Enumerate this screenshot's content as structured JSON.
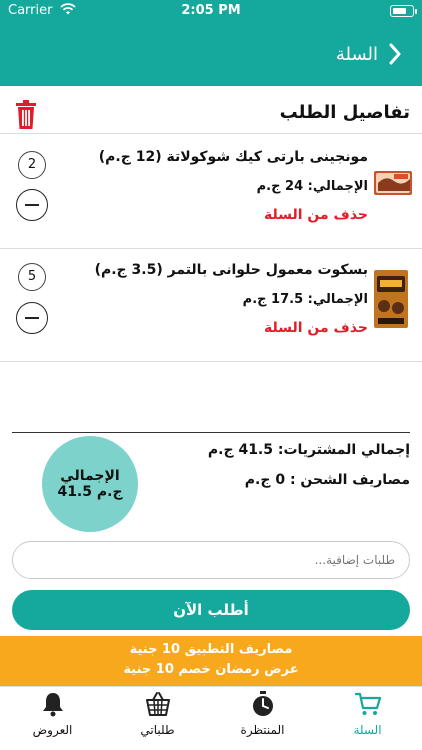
{
  "status_bar": {
    "carrier": "Carrier",
    "time": "2:05 PM"
  },
  "nav": {
    "back_label": "السلة"
  },
  "section": {
    "title": "تفاصيل الطلب"
  },
  "items": [
    {
      "name": "مونجينى بارتى كيك شوكولاتة (12 ج.م)",
      "total": "الإجمالي: 24 ج.م",
      "remove": "حذف من السلة",
      "qty": "2",
      "thumb": "cake-thumbnail"
    },
    {
      "name": "بسكوت معمول حلوانى بالتمر (3.5 ج.م)",
      "total": "الإجمالي: 17.5 ج.م",
      "remove": "حذف من السلة",
      "qty": "5",
      "thumb": "maamoul-thumbnail"
    }
  ],
  "summary": {
    "purchases": "إجمالي المشتريات: 41.5 ج.م",
    "shipping": "مصاريف الشحن : 0 ج.م",
    "total_label": "الإجمالي",
    "total_value": "41.5 ج.م"
  },
  "notes": {
    "placeholder": "طلبات إضافية..."
  },
  "order_button": "أطلب الآن",
  "promo": {
    "line1": "مصاريف التطبيق 10 جنية",
    "line2": "عرض رمضان خصم 10 جنية"
  },
  "tabs": [
    {
      "label": "العروض",
      "icon": "bell-icon",
      "active": false
    },
    {
      "label": "طلباتي",
      "icon": "basket-icon",
      "active": false
    },
    {
      "label": "المنتظرة",
      "icon": "stopwatch-icon",
      "active": false
    },
    {
      "label": "السلة",
      "icon": "cart-icon",
      "active": true
    }
  ],
  "colors": {
    "primary": "#14a99c",
    "circle": "#7dd3cc",
    "danger": "#e11d2a",
    "promo": "#f7a81c"
  }
}
